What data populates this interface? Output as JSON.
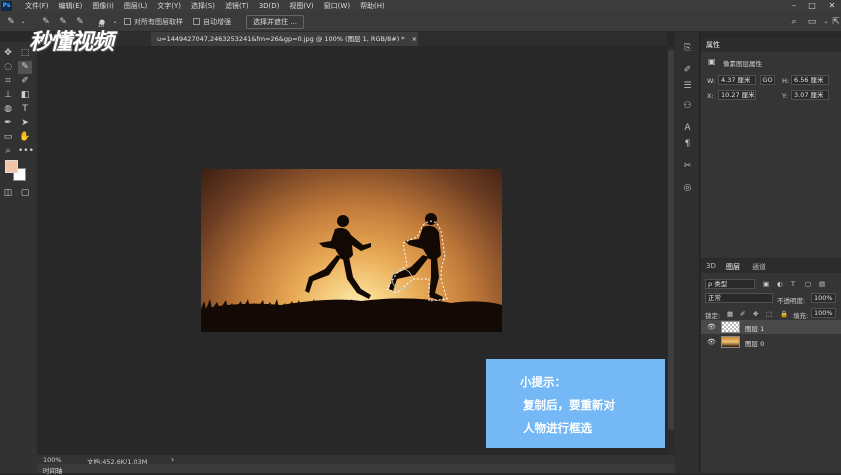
{
  "menubar": {
    "items": [
      "文件(F)",
      "编辑(E)",
      "图像(I)",
      "图层(L)",
      "文字(Y)",
      "选择(S)",
      "滤镜(T)",
      "3D(D)",
      "视图(V)",
      "窗口(W)",
      "帮助(H)"
    ]
  },
  "options": {
    "brush_size": "10",
    "sample_all_layers": "对所有图层取样",
    "auto_enhance": "自动增强",
    "select_and_mask": "选择并遮住 ..."
  },
  "watermark": "秒懂视频",
  "document": {
    "tab_title": "u=1449427047,2463253241&fm=26&gp=0.jpg @ 100% (图层 1, RGB/8#) *",
    "close": "×"
  },
  "status": {
    "zoom": "100%",
    "doc_size": "文档:452.6K/1.03M",
    "arrow": "›"
  },
  "timeline_label": "时间轴",
  "tip": {
    "title": "小提示：",
    "line1": "复制后，要重新对",
    "line2": "人物进行框选"
  },
  "properties": {
    "tab": "属性",
    "section": "像素图层属性",
    "w_label": "W:",
    "w_value": "4.37 厘米",
    "link": "GO",
    "h_label": "H:",
    "h_value": "6.56 厘米",
    "x_label": "X:",
    "x_value": "10.27 厘米",
    "y_label": "Y:",
    "y_value": "3.07 厘米"
  },
  "layers": {
    "tabs": [
      "3D",
      "图层",
      "通道"
    ],
    "filter": "ρ 类型",
    "blend_mode": "正常",
    "opacity_label": "不透明度:",
    "opacity": "100%",
    "lock_label": "锁定:",
    "fill_label": "填充:",
    "fill": "100%",
    "items": [
      {
        "name": "图层 1"
      },
      {
        "name": "图层 0"
      }
    ]
  },
  "colors": {
    "foreground": "#f3c3a7",
    "background": "#ffffff",
    "tip_bg": "#74b9f6"
  }
}
